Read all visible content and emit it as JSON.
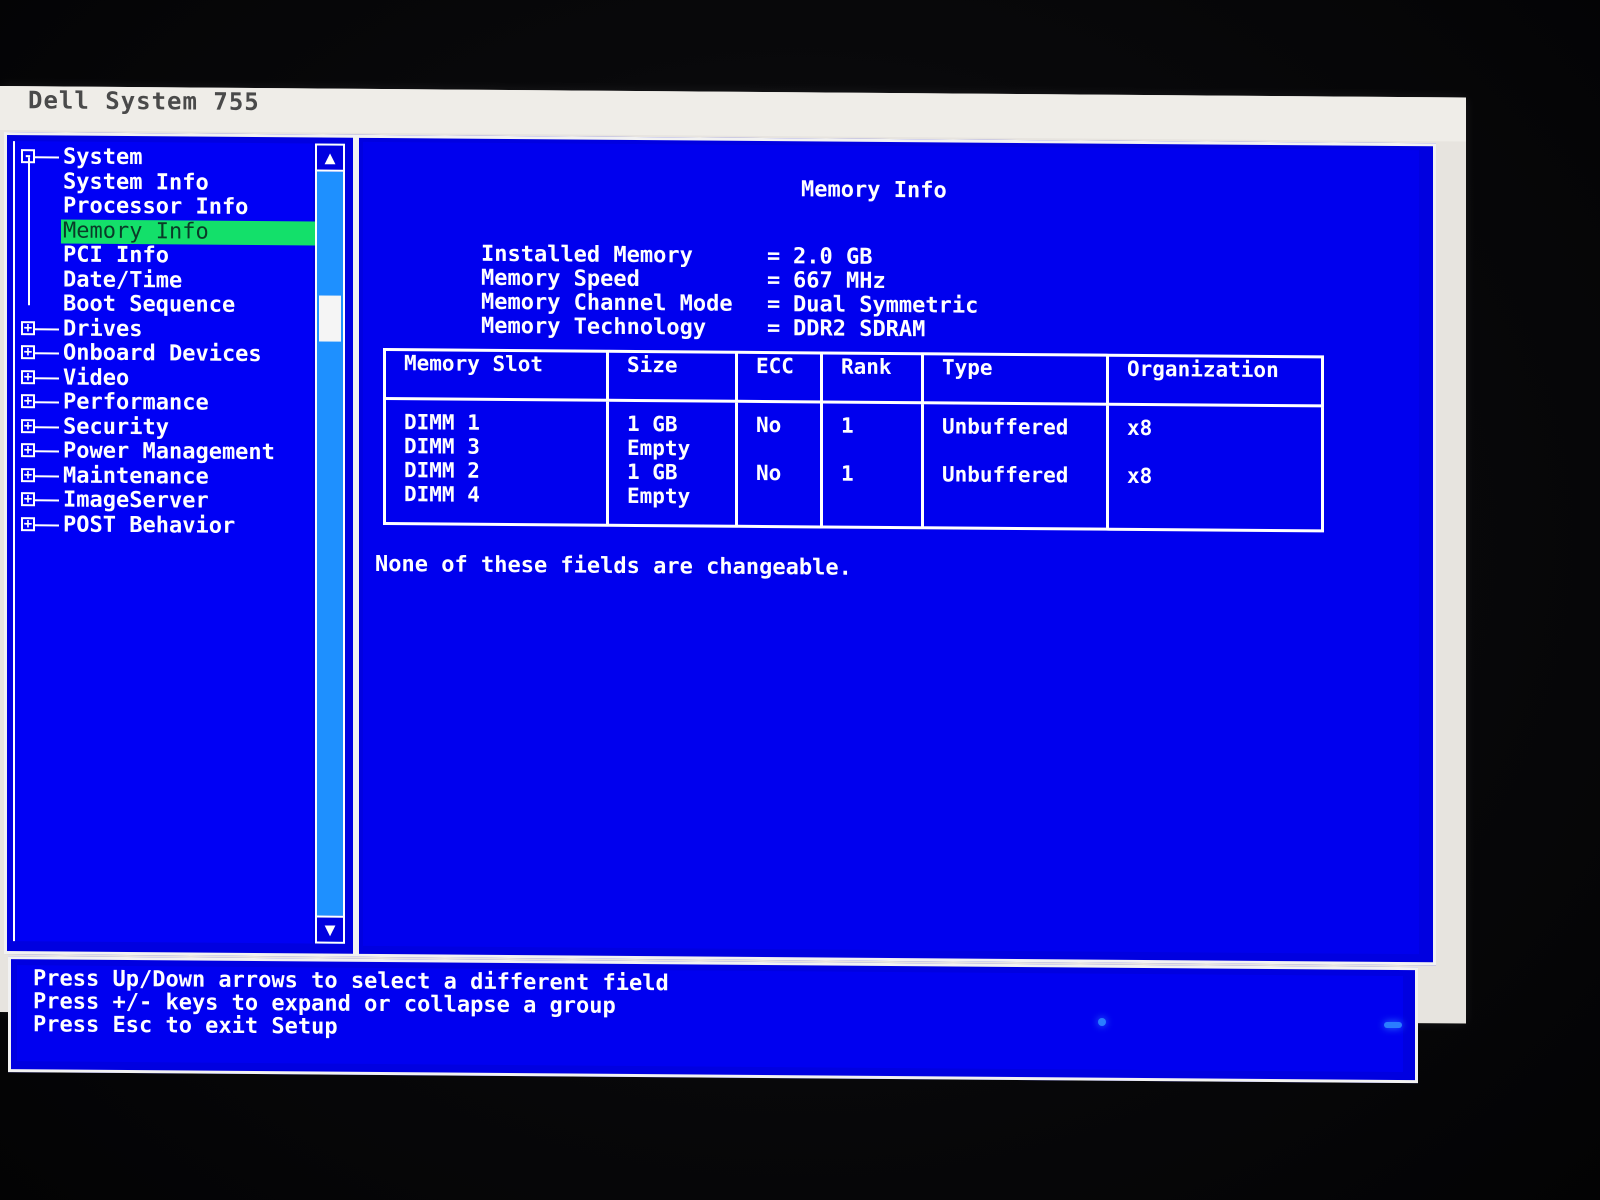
{
  "window": {
    "title": "Dell System 755"
  },
  "sidebar": {
    "items": [
      {
        "label": "System",
        "type": "group",
        "state": "-"
      },
      {
        "label": "System Info",
        "type": "child"
      },
      {
        "label": "Processor Info",
        "type": "child"
      },
      {
        "label": "Memory Info",
        "type": "child",
        "selected": true
      },
      {
        "label": "PCI Info",
        "type": "child"
      },
      {
        "label": "Date/Time",
        "type": "child"
      },
      {
        "label": "Boot Sequence",
        "type": "child"
      },
      {
        "label": "Drives",
        "type": "group",
        "state": "+"
      },
      {
        "label": "Onboard Devices",
        "type": "group",
        "state": "+"
      },
      {
        "label": "Video",
        "type": "group",
        "state": "+"
      },
      {
        "label": "Performance",
        "type": "group",
        "state": "+"
      },
      {
        "label": "Security",
        "type": "group",
        "state": "+"
      },
      {
        "label": "Power Management",
        "type": "group",
        "state": "+"
      },
      {
        "label": "Maintenance",
        "type": "group",
        "state": "+"
      },
      {
        "label": "ImageServer",
        "type": "group",
        "state": "+"
      },
      {
        "label": "POST Behavior",
        "type": "group",
        "state": "+"
      }
    ],
    "scroll_up_icon": "▲",
    "scroll_down_icon": "▼"
  },
  "main": {
    "title": "Memory Info",
    "fields": [
      {
        "label": "Installed Memory",
        "value": "2.0 GB"
      },
      {
        "label": "Memory Speed",
        "value": "667 MHz"
      },
      {
        "label": "Memory Channel Mode",
        "value": "Dual Symmetric"
      },
      {
        "label": "Memory Technology",
        "value": "DDR2 SDRAM"
      }
    ],
    "equals": "=",
    "table": {
      "headers": [
        "Memory Slot",
        "Size",
        "ECC",
        "Rank",
        "Type",
        "Organization"
      ],
      "rows": [
        [
          "DIMM 1",
          "1 GB",
          "No",
          "1",
          "Unbuffered",
          "x8"
        ],
        [
          "DIMM 3",
          "Empty",
          "",
          "",
          "",
          ""
        ],
        [
          "DIMM 2",
          "1 GB",
          "No",
          "1",
          "Unbuffered",
          "x8"
        ],
        [
          "DIMM 4",
          "Empty",
          "",
          "",
          "",
          ""
        ]
      ]
    },
    "note": "None of these fields are changeable."
  },
  "help": {
    "lines": [
      "Press Up/Down arrows to select a different field",
      "Press +/- keys to expand or collapse a group",
      "Press Esc to exit Setup"
    ]
  },
  "colors": {
    "panel_blue": "#0000ee",
    "selection_green": "#13e06a",
    "scrollbar_blue": "#1e90ff"
  }
}
